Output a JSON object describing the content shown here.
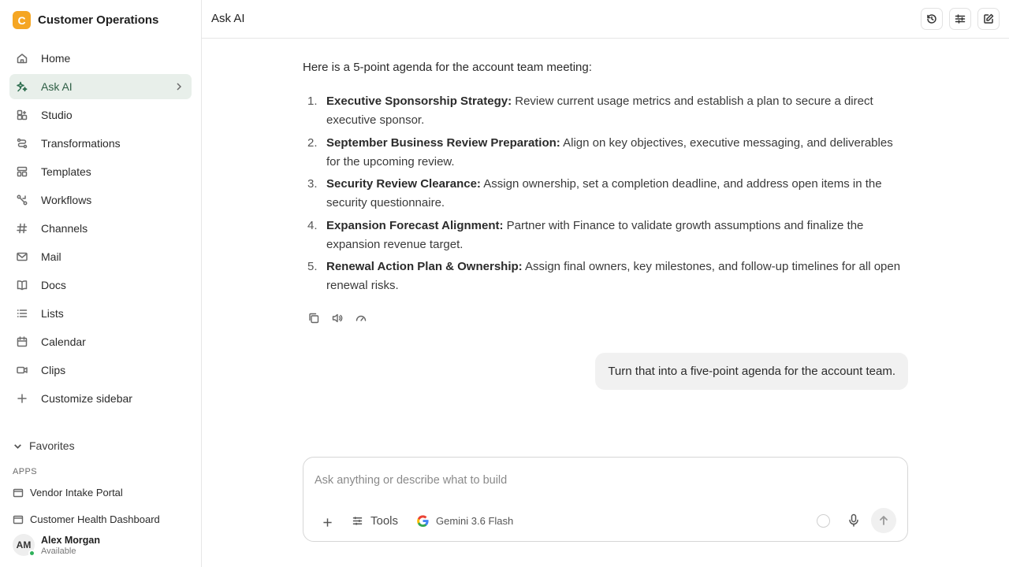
{
  "workspace": {
    "initial": "C",
    "name": "Customer Operations",
    "badge_color": "#f5a623"
  },
  "sidebar": {
    "items": [
      {
        "label": "Home",
        "icon": "home-icon"
      },
      {
        "label": "Ask AI",
        "icon": "sparkle-icon",
        "active": true
      },
      {
        "label": "Studio",
        "icon": "studio-icon"
      },
      {
        "label": "Transformations",
        "icon": "transform-icon"
      },
      {
        "label": "Templates",
        "icon": "template-icon"
      },
      {
        "label": "Workflows",
        "icon": "workflow-icon"
      },
      {
        "label": "Channels",
        "icon": "hash-icon"
      },
      {
        "label": "Mail",
        "icon": "mail-icon"
      },
      {
        "label": "Docs",
        "icon": "book-icon"
      },
      {
        "label": "Lists",
        "icon": "list-icon"
      },
      {
        "label": "Calendar",
        "icon": "calendar-icon"
      },
      {
        "label": "Clips",
        "icon": "video-icon"
      },
      {
        "label": "Customize sidebar",
        "icon": "plus-icon"
      }
    ],
    "favorites_label": "Favorites",
    "apps_label": "APPS",
    "apps": [
      {
        "label": "Vendor Intake Portal"
      },
      {
        "label": "Customer Health Dashboard"
      }
    ],
    "user": {
      "initials": "AM",
      "name": "Alex Morgan",
      "status": "Available",
      "status_color": "#2fb15b"
    }
  },
  "header": {
    "title": "Ask AI",
    "buttons": [
      "history-icon",
      "settings-sliders-icon",
      "new-chat-icon"
    ]
  },
  "conversation": {
    "assistant_intro": "Here is a 5-point agenda for the account team meeting:",
    "agenda": [
      {
        "num": "1.",
        "title": "Executive Sponsorship Strategy:",
        "text": " Review current usage metrics and establish a plan to secure a direct executive sponsor."
      },
      {
        "num": "2.",
        "title": "September Business Review Preparation:",
        "text": " Align on key objectives, executive messaging, and deliverables for the upcoming review."
      },
      {
        "num": "3.",
        "title": "Security Review Clearance:",
        "text": " Assign ownership, set a completion deadline, and address open items in the security questionnaire."
      },
      {
        "num": "4.",
        "title": "Expansion Forecast Alignment:",
        "text": " Partner with Finance to validate growth assumptions and finalize the expansion revenue target."
      },
      {
        "num": "5.",
        "title": "Renewal Action Plan & Ownership:",
        "text": " Assign final owners, key milestones, and follow-up timelines for all open renewal risks."
      }
    ],
    "user_message": "Turn that into a five-point agenda for the account team."
  },
  "composer": {
    "placeholder": "Ask anything or describe what to build",
    "tools_label": "Tools",
    "model_label": "Gemini 3.6 Flash"
  }
}
